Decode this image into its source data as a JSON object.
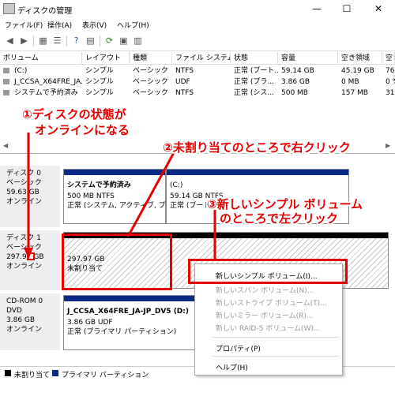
{
  "window": {
    "title": "ディスクの管理",
    "controls": [
      "—",
      "☐",
      "✕"
    ]
  },
  "menu": [
    "ファイル(F)",
    "操作(A)",
    "表示(V)",
    "ヘルプ(H)"
  ],
  "table": {
    "headers": [
      "ボリューム",
      "レイアウト",
      "種類",
      "ファイル システム",
      "状態",
      "容量",
      "空き領域",
      "空き"
    ],
    "rows": [
      [
        "(C:)",
        "シンプル",
        "ベーシック",
        "NTFS",
        "正常 (ブート...",
        "59.14 GB",
        "45.19 GB",
        "76 '"
      ],
      [
        "J_CCSA_X64FRE_JA...",
        "シンプル",
        "ベーシック",
        "UDF",
        "正常 (プラ...",
        "3.86 GB",
        "0 MB",
        "0 %"
      ],
      [
        "システムで予約済み",
        "シンプル",
        "ベーシック",
        "NTFS",
        "正常 (シス...",
        "500 MB",
        "157 MB",
        "31 '"
      ]
    ]
  },
  "disks": [
    {
      "name": "ディスク 0",
      "type": "ベーシック",
      "size": "59.63 GB",
      "status": "オンライン",
      "partitions": [
        {
          "name": "システムで予約済み",
          "size": "500 MB NTFS",
          "status": "正常 (システム, アクティブ, プライ"
        },
        {
          "name": "(C:)",
          "size": "59.14 GB NTFS",
          "status": "正常 (ブート,"
        }
      ]
    },
    {
      "name": "ディスク 1",
      "type": "ベーシック",
      "size": "297.97 GB",
      "status": "オンライン",
      "partitions": [
        {
          "name": "",
          "size": "297.97 GB",
          "status": "未割り当て"
        }
      ]
    },
    {
      "name": "CD-ROM 0",
      "type": "DVD",
      "size": "3.86 GB",
      "status": "オンライン",
      "partitions": [
        {
          "name": "J_CCSA_X64FRE_JA-JP_DV5 (D:)",
          "size": "3.86 GB UDF",
          "status": "正常 (プライマリ パーティション)"
        }
      ]
    }
  ],
  "context_menu": [
    {
      "label": "新しいシンプル ボリューム(I)...",
      "enabled": true
    },
    {
      "label": "新しいスパン ボリューム(N)...",
      "enabled": false
    },
    {
      "label": "新しいストライプ ボリューム(T)...",
      "enabled": false
    },
    {
      "label": "新しいミラー ボリューム(R)...",
      "enabled": false
    },
    {
      "label": "新しい RAID-5 ボリューム(W)...",
      "enabled": false
    },
    {
      "label": "プロパティ(P)",
      "enabled": true
    },
    {
      "label": "ヘルプ(H)",
      "enabled": true
    }
  ],
  "legend": [
    {
      "label": "未割り当て",
      "color": "#000000"
    },
    {
      "label": "プライマリ パーティション",
      "color": "#0a2a8a"
    }
  ],
  "annotations": {
    "step1_line1": "①ディスクの状態が",
    "step1_line2": "オンラインになる",
    "step2": "②未割り当てのところで右クリック",
    "step3_line1": "③新しいシンプル ボリューム",
    "step3_line2": "のところで左クリック"
  },
  "colors": {
    "annotation_red": "#e60000",
    "primary_stripe": "#0a2a8a",
    "unallocated_stripe": "#000000"
  }
}
